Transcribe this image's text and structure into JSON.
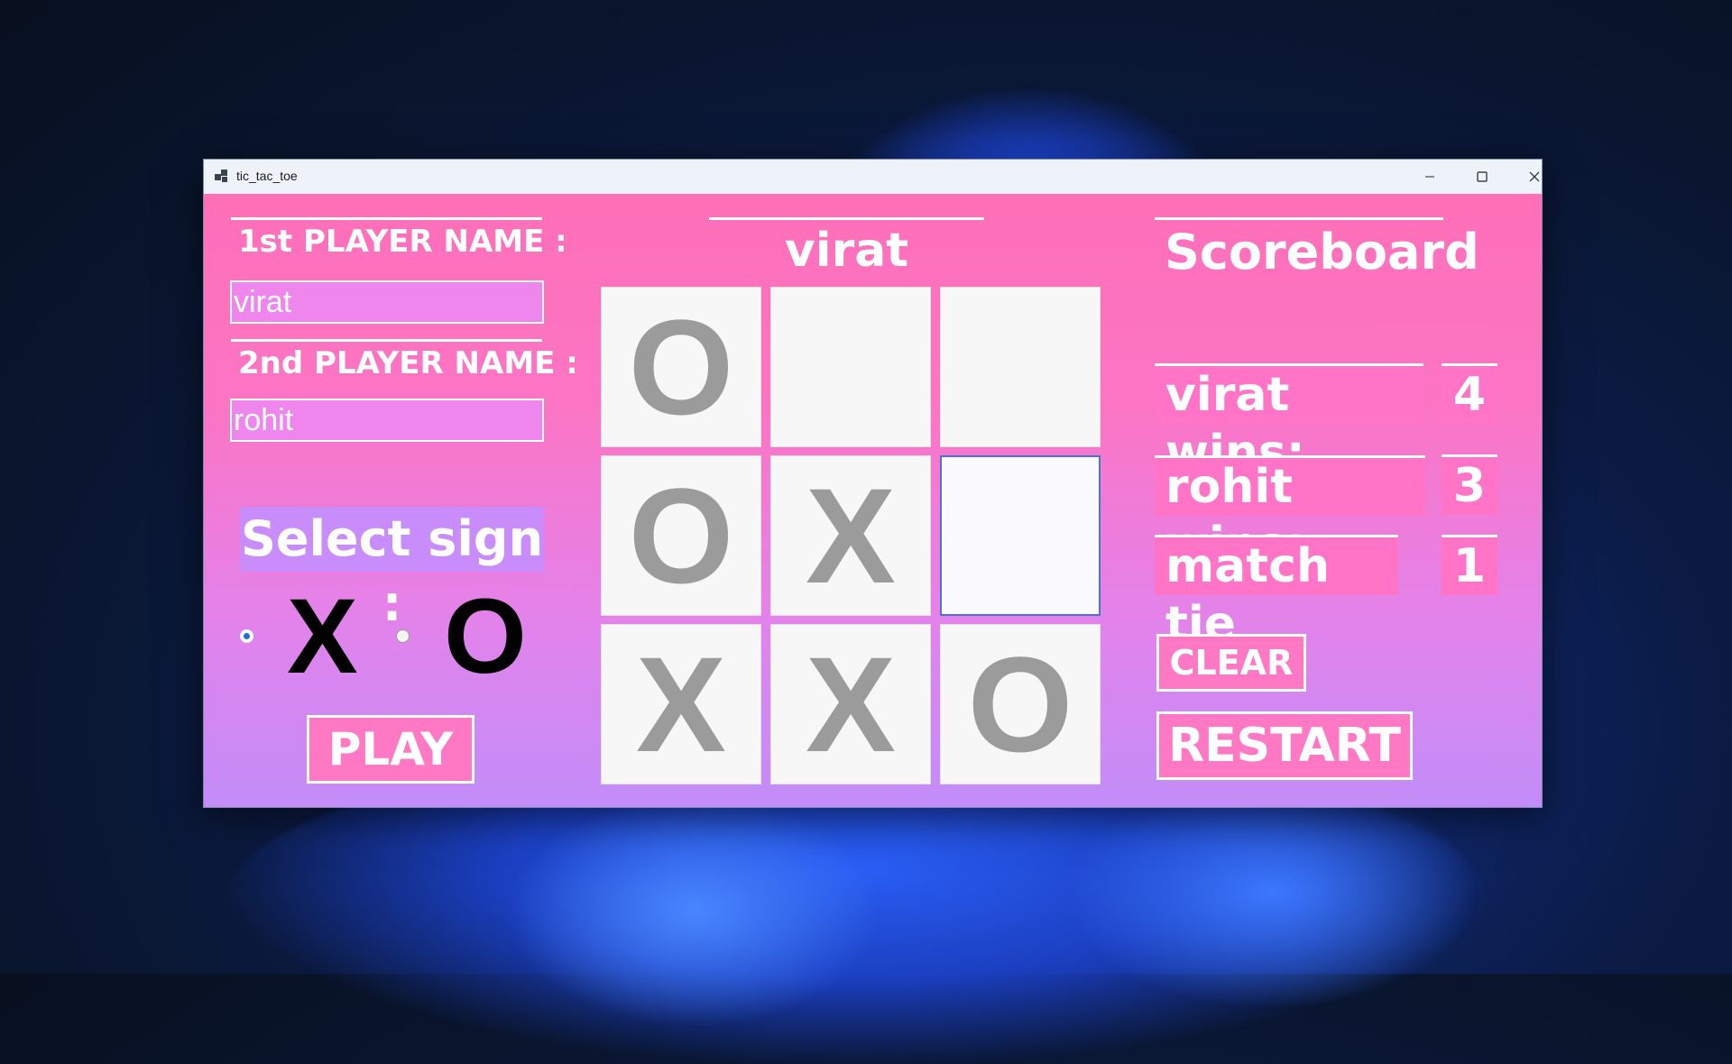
{
  "window": {
    "title": "tic_tac_toe"
  },
  "players": {
    "first_label": "1st PLAYER NAME  :",
    "first_value": "virat",
    "second_label": "2nd PLAYER NAME :",
    "second_value": "rohit"
  },
  "sign": {
    "label": "Select sign :",
    "options": [
      "X",
      "O"
    ],
    "selected": "X"
  },
  "play_label": "PLAY",
  "turn_label": "virat TURN",
  "board": [
    "O",
    "",
    "",
    "O",
    "X",
    "",
    "X",
    "X",
    "O"
  ],
  "scoreboard": {
    "title": "Scoreboard",
    "rows": [
      {
        "label": "virat wins:",
        "value": "4"
      },
      {
        "label": "rohit wins:",
        "value": "3"
      },
      {
        "label": "match tie",
        "value": "1"
      }
    ]
  },
  "clear_label": "CLEAR",
  "restart_label": "RESTART",
  "colors": {
    "gradient_top": "#ff6fb8",
    "gradient_bottom": "#c28df8",
    "mark": "#9b9b9b",
    "radio_selected": "#1f6fd1"
  }
}
